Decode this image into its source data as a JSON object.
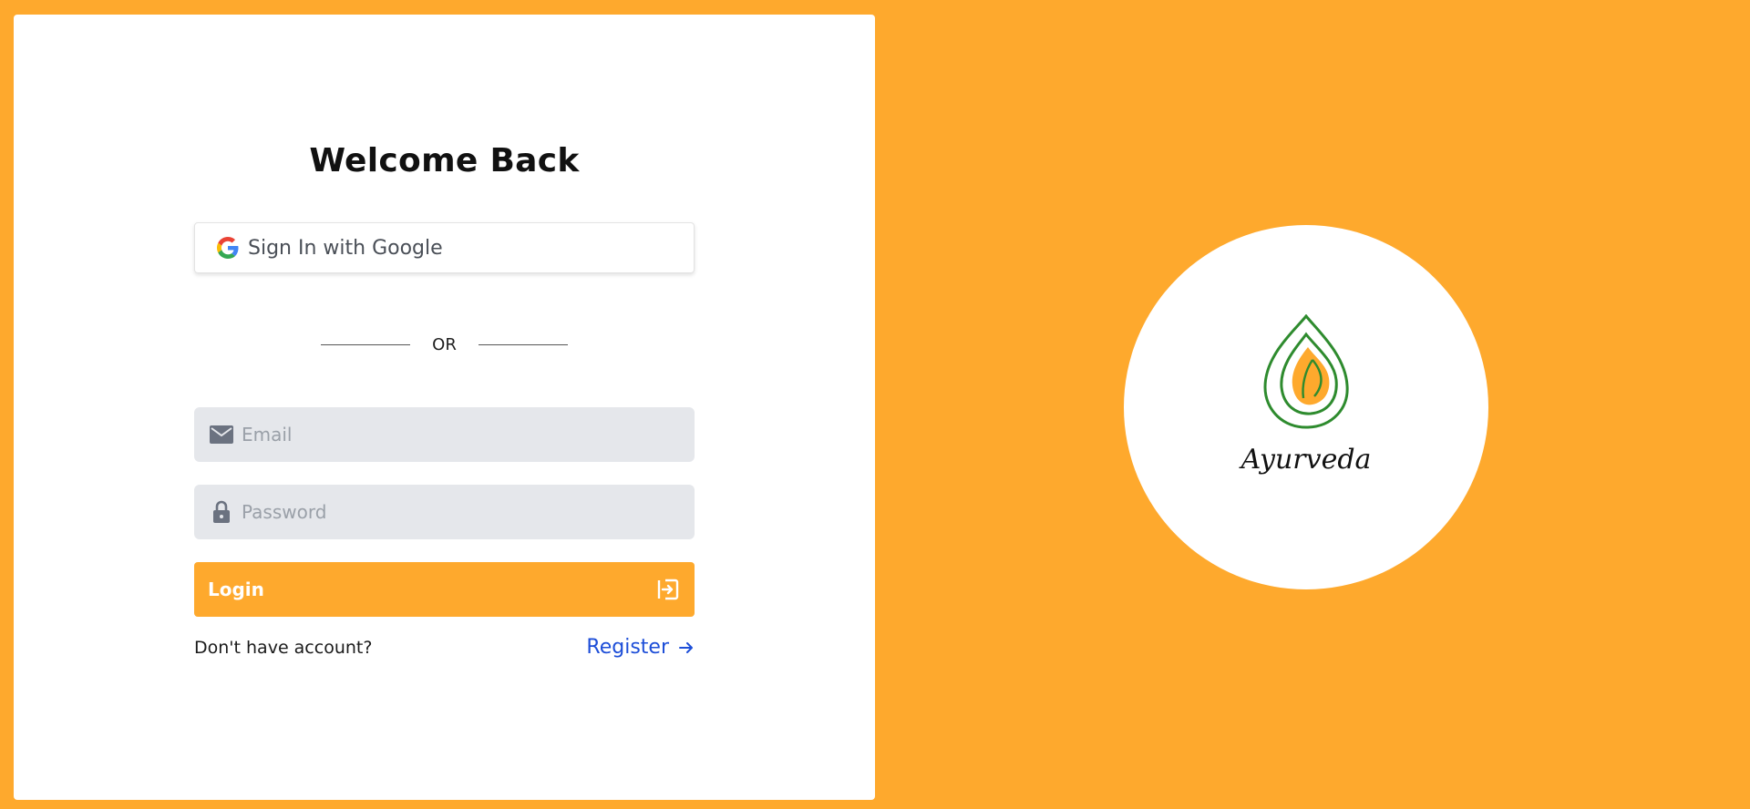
{
  "login": {
    "title": "Welcome Back",
    "google_button_label": "Sign In with Google",
    "divider_text": "OR",
    "email": {
      "placeholder": "Email",
      "value": ""
    },
    "password": {
      "placeholder": "Password",
      "value": ""
    },
    "login_button_label": "Login",
    "no_account_text": "Don't have account?",
    "register_link_label": "Register"
  },
  "brand": {
    "name": "Ayurveda"
  },
  "colors": {
    "background": "#fea92d",
    "accent": "#fea92d",
    "link": "#1d4ed8",
    "logo_green": "#2e8b2e",
    "input_bg": "#e5e7eb"
  },
  "icons": {
    "google": "google-icon",
    "email": "envelope-icon",
    "password": "lock-icon",
    "login": "sign-in-icon",
    "register": "arrow-right-icon",
    "logo": "drop-leaf-icon"
  }
}
